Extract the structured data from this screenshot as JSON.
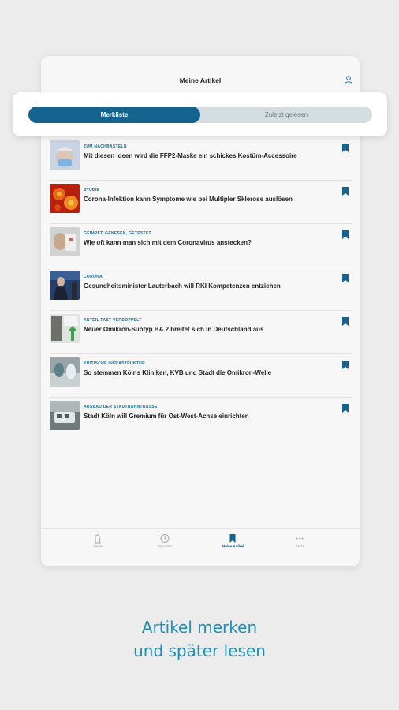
{
  "header": {
    "title": "Meine Artikel",
    "user_icon": "user-icon"
  },
  "segments": {
    "active": "Merkliste",
    "inactive": "Zuletzt gelesen"
  },
  "articles": [
    {
      "kicker": "Zum Nachbasteln",
      "headline": "Mit diesen Ideen wird die FFP2-Maske ein schickes Kostüm-Accessoire",
      "thumb": "mask-photo"
    },
    {
      "kicker": "Studie",
      "headline": "Corona-Infektion kann Symptome wie bei Multipler Sklerose auslösen",
      "thumb": "virus-photo"
    },
    {
      "kicker": "Geimpft, genesen, getestet",
      "headline": "Wie oft kann man sich mit dem Coronavirus anstecken?",
      "thumb": "test-photo"
    },
    {
      "kicker": "Corona",
      "headline": "Gesundheitsminister Lauterbach will RKI Kompetenzen entziehen",
      "thumb": "minister-photo"
    },
    {
      "kicker": "Anteil fast verdoppelt",
      "headline": "Neuer Omikron-Subtyp BA.2 breitet sich in Deutschland aus",
      "thumb": "chart-photo"
    },
    {
      "kicker": "Kritische Infrastruktur",
      "headline": "So stemmen Kölns Kliniken, KVB und Stadt die Omikron-Welle",
      "thumb": "clinic-photo"
    },
    {
      "kicker": "Ausbau der Stadtbahntrasse",
      "headline": "Stadt Köln will Gremium für Ost-West-Achse einrichten",
      "thumb": "tram-photo"
    }
  ],
  "tabbar": [
    {
      "label": "Home",
      "icon": "home-icon",
      "active": false
    },
    {
      "label": "Neueste",
      "icon": "clock-icon",
      "active": false
    },
    {
      "label": "Meine Artikel",
      "icon": "bookmark-icon",
      "active": true
    },
    {
      "label": "Mehr",
      "icon": "more-icon",
      "active": false
    }
  ],
  "promo": {
    "line1": "Artikel merken",
    "line2": "und später lesen"
  },
  "colors": {
    "accent": "#14648f",
    "promo": "#1a8fb8",
    "kicker": "#1b6d8f"
  }
}
